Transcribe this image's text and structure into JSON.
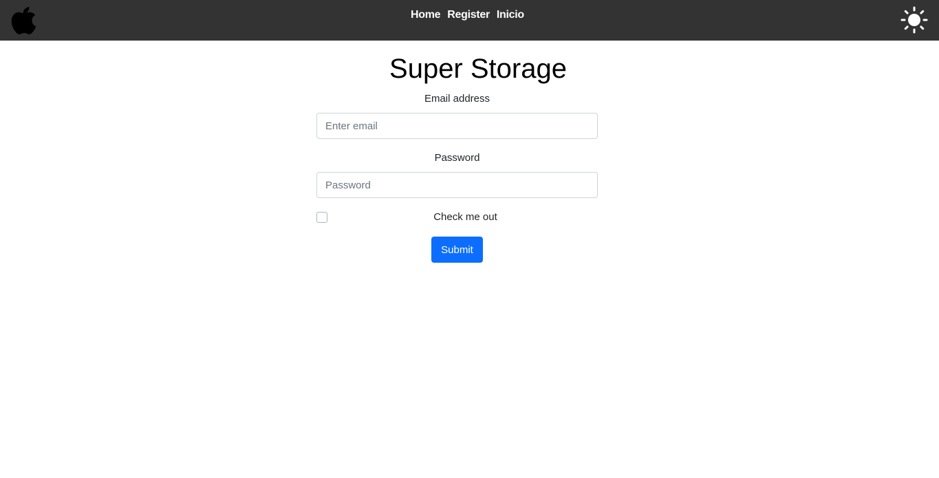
{
  "navbar": {
    "logo_icon": "apple-logo-icon",
    "links": [
      {
        "label": "Home"
      },
      {
        "label": "Register"
      },
      {
        "label": "Inicio"
      }
    ],
    "theme_icon": "sun-icon"
  },
  "page": {
    "title": "Super Storage"
  },
  "form": {
    "email_label": "Email address",
    "email_placeholder": "Enter email",
    "email_value": "",
    "password_label": "Password",
    "password_placeholder": "Password",
    "password_value": "",
    "checkbox_label": "Check me out",
    "checkbox_checked": false,
    "submit_label": "Submit"
  },
  "colors": {
    "navbar_bg": "#333333",
    "primary_button": "#0d6efd"
  }
}
